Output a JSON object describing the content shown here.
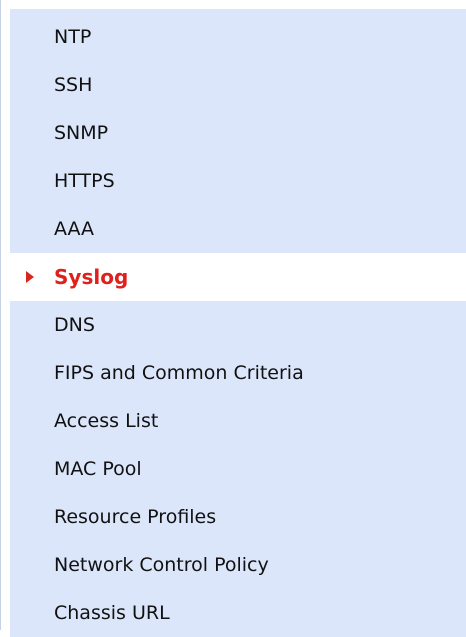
{
  "nav": {
    "active_index": 5,
    "active_color": "#e0201c",
    "background_color": "#dbe6fa",
    "active_indicator_icon": "caret-right-icon",
    "items": [
      {
        "label": "NTP"
      },
      {
        "label": "SSH"
      },
      {
        "label": "SNMP"
      },
      {
        "label": "HTTPS"
      },
      {
        "label": "AAA"
      },
      {
        "label": "Syslog"
      },
      {
        "label": "DNS"
      },
      {
        "label": "FIPS and Common Criteria"
      },
      {
        "label": "Access List"
      },
      {
        "label": "MAC Pool"
      },
      {
        "label": "Resource Profiles"
      },
      {
        "label": "Network Control Policy"
      },
      {
        "label": "Chassis URL"
      }
    ]
  }
}
